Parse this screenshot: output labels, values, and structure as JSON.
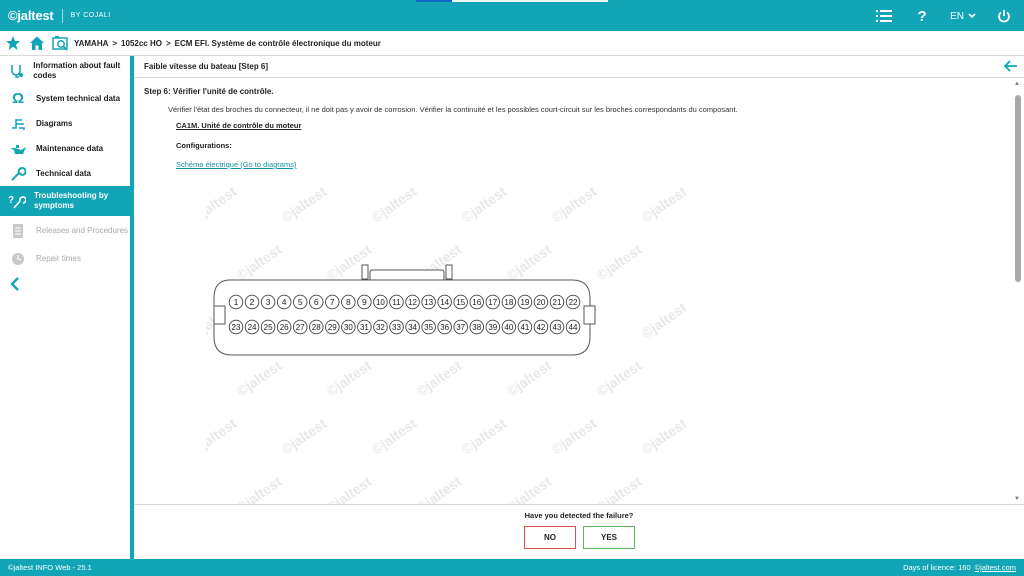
{
  "topbar": {
    "logo": "©jaltest",
    "by": "BY COJALI",
    "progress_fraction": 0.19,
    "language": "EN",
    "icons": [
      "list-icon",
      "help-icon",
      "language-selector",
      "power-icon"
    ]
  },
  "breadcrumb": {
    "items": [
      "YAMAHA",
      ">",
      "1052cc HO",
      ">",
      "ECM EFI. Système de contrôle électronique du moteur"
    ]
  },
  "sidebar": {
    "items": [
      {
        "label": "Information about fault codes",
        "icon": "fault-codes-icon",
        "state": "normal"
      },
      {
        "label": "System technical data",
        "icon": "omega-icon",
        "state": "normal"
      },
      {
        "label": "Diagrams",
        "icon": "diagram-icon",
        "state": "normal"
      },
      {
        "label": "Maintenance data",
        "icon": "oil-can-icon",
        "state": "normal"
      },
      {
        "label": "Technical data",
        "icon": "wrench-icon",
        "state": "normal"
      },
      {
        "label": "Troubleshooting by symptoms",
        "icon": "troubleshooting-icon",
        "state": "active"
      },
      {
        "label": "Releases and Procedures",
        "icon": "document-icon",
        "state": "disabled"
      },
      {
        "label": "Repair times",
        "icon": "clock-icon",
        "state": "disabled"
      }
    ]
  },
  "main": {
    "title": "Faible vitesse du bateau [Step 6]",
    "step_title": "Step 6: Vérifier l'unité de contrôle.",
    "step_desc": "Vérifier l'état des broches du connecteur, il ne doit pas y avoir de corrosion. Vérifier la continuité et les possibles court-circuit sur les broches correspondants du composant.",
    "component": "CA1M. Unité de contrôle du moteur",
    "configurations": "Configurations:",
    "diagram_link": "Schéma électrique (Go to diagrams)",
    "watermark": "©jaltest",
    "connector": {
      "row1": [
        "1",
        "2",
        "3",
        "4",
        "5",
        "6",
        "7",
        "8",
        "9",
        "10",
        "11",
        "12",
        "13",
        "14",
        "15",
        "16",
        "17",
        "18",
        "19",
        "20",
        "21",
        "22"
      ],
      "row2": [
        "23",
        "24",
        "25",
        "26",
        "27",
        "28",
        "29",
        "30",
        "31",
        "32",
        "33",
        "34",
        "35",
        "36",
        "37",
        "38",
        "39",
        "40",
        "41",
        "42",
        "43",
        "44"
      ]
    }
  },
  "question": {
    "text": "Have you detected the failure?",
    "no": "NO",
    "yes": "YES"
  },
  "footer": {
    "left": "©jaltest INFO Web - 25.1",
    "licence": "Days of licence: 160",
    "link": "©jaltest.com"
  },
  "colors": {
    "accent": "#12a5b5",
    "no_border": "#d9534f",
    "yes_border": "#5cb85c"
  }
}
